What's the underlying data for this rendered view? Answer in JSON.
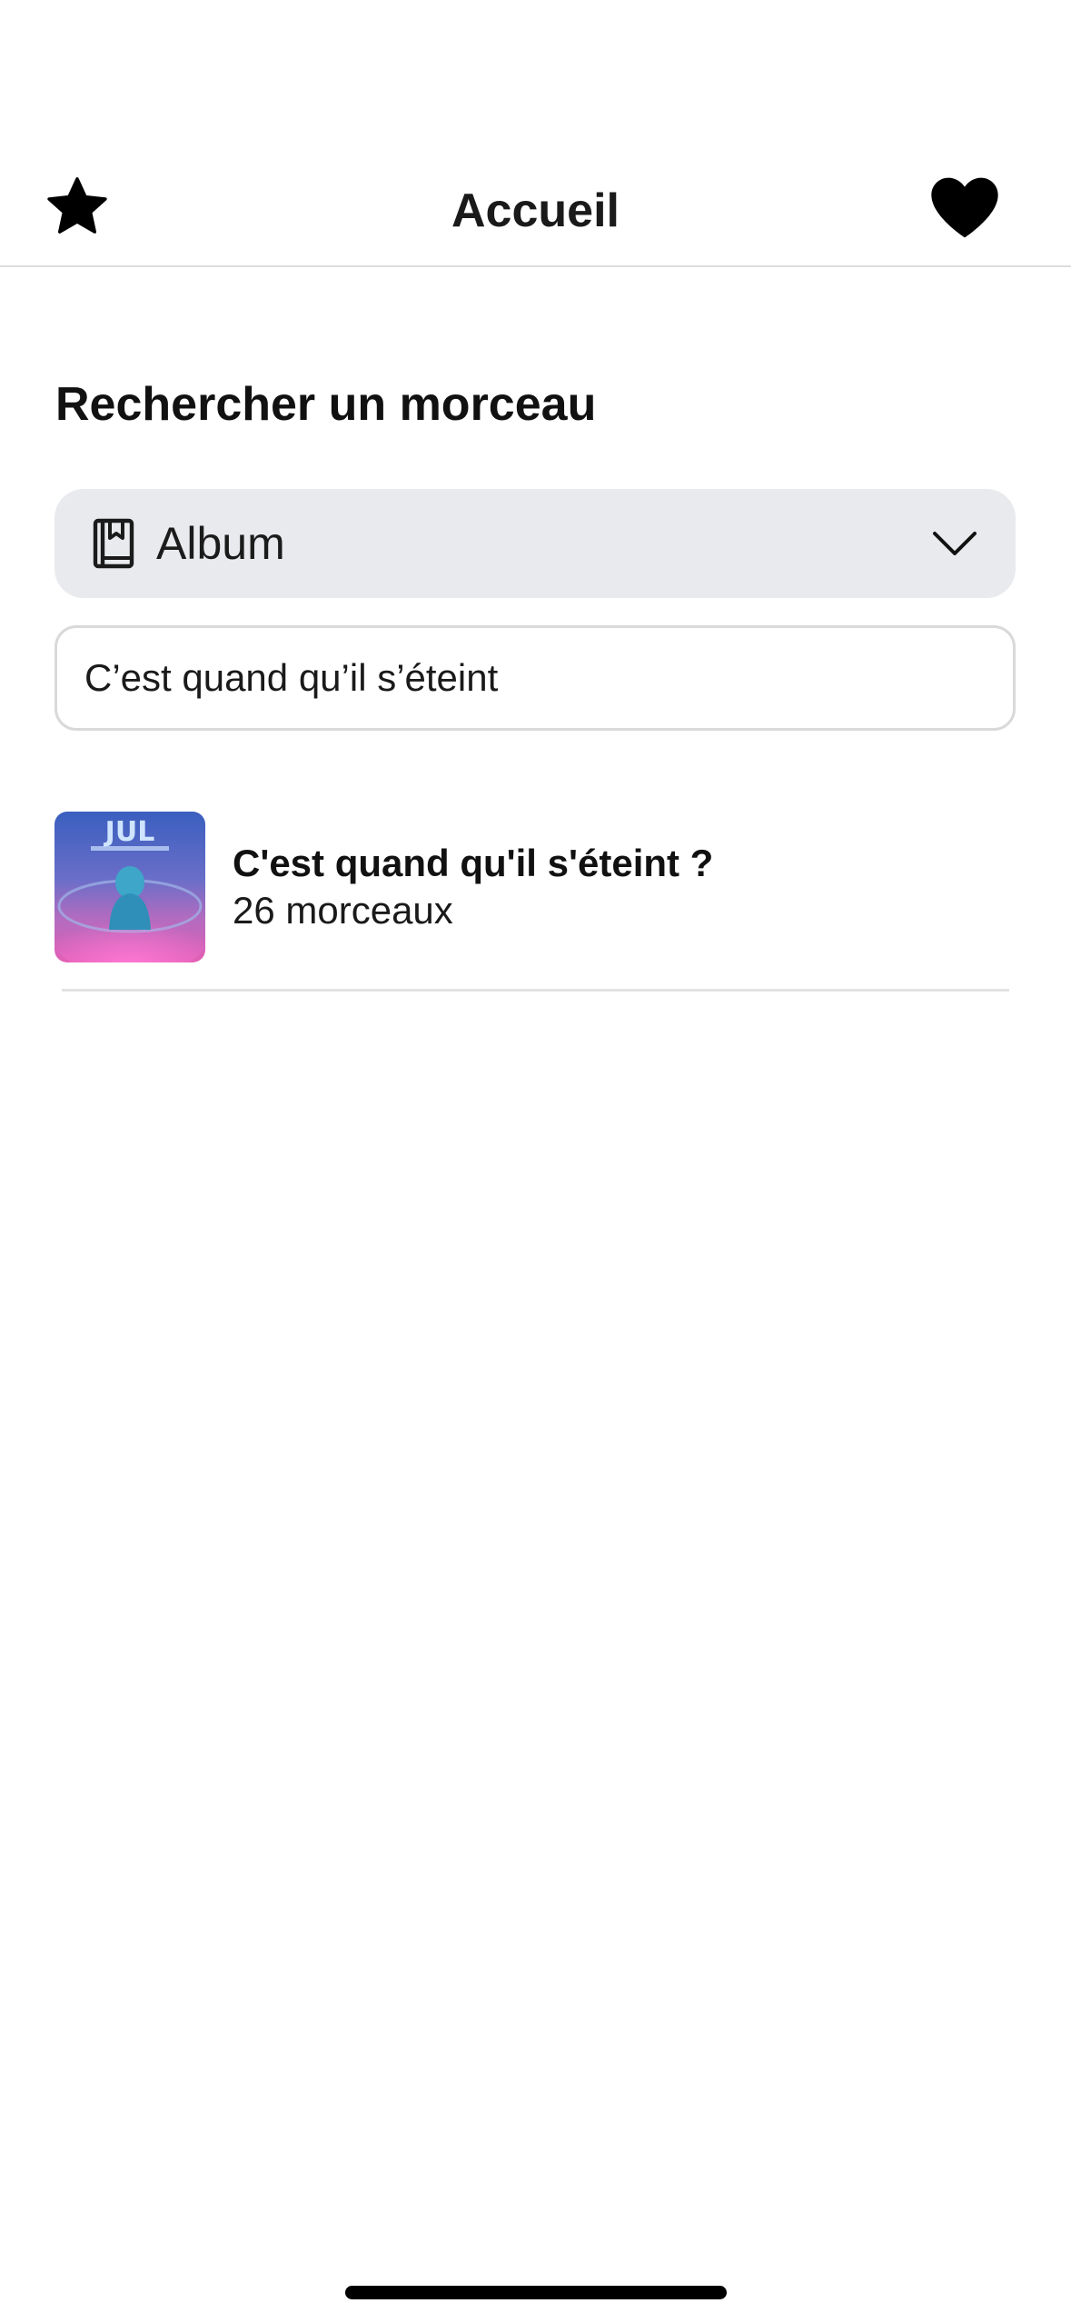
{
  "header": {
    "title": "Accueil",
    "left_icon": "star-icon",
    "right_icon": "heart-icon"
  },
  "search": {
    "section_title": "Rechercher un morceau",
    "type_selector": {
      "icon": "book-icon",
      "selected": "Album"
    },
    "query": "C’est quand qu’il s’éteint"
  },
  "results": [
    {
      "title": "C'est quand qu'il s'éteint ?",
      "subtitle": "26 morceaux",
      "cover_text": "JUL"
    }
  ],
  "colors": {
    "dropdown_bg": "#e8eaed",
    "divider": "#dcdcdc",
    "text": "#111111"
  }
}
